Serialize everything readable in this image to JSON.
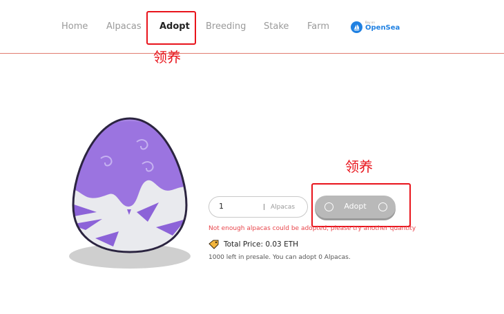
{
  "nav": {
    "items": [
      {
        "label": "Home"
      },
      {
        "label": "Alpacas"
      },
      {
        "label": "Adopt",
        "active": true
      },
      {
        "label": "Breeding"
      },
      {
        "label": "Stake"
      },
      {
        "label": "Farm"
      }
    ],
    "opensea": {
      "small_text": "Buy on",
      "name": "OpenSea"
    }
  },
  "annotations": {
    "nav_note": "领养",
    "button_note": "领养",
    "color": "#e8121a"
  },
  "adopt": {
    "quantity_value": "1",
    "quantity_unit": "Alpacas",
    "button_label": "Adopt",
    "error": "Not enough alpacas could be adopted, please try another quantity",
    "total_price": "Total Price: 0.03 ETH",
    "presale_info": "1000 left in presale. You can adopt 0 Alpacas."
  },
  "colors": {
    "accent_line": "#e07b6f",
    "button": "#b9b9b9",
    "error": "#e8444a",
    "egg_purple": "#9b74e0",
    "opensea_blue": "#2081e2"
  }
}
